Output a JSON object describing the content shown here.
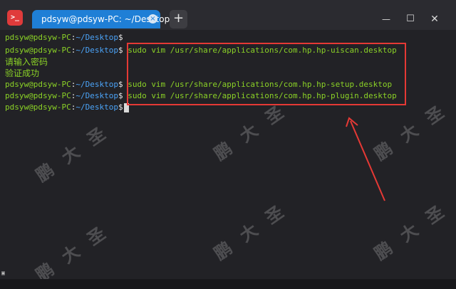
{
  "titlebar": {
    "app_icon_text": ">_",
    "tab_label": "pdsyw@pdsyw-PC: ~/Desktop",
    "tab_close": "×",
    "new_tab": "+",
    "minimize": "—",
    "maximize": "☐",
    "close": "✕"
  },
  "terminal": {
    "lines": [
      {
        "user": "pdsyw@pdsyw-PC",
        "sep": ":",
        "path": "~/Desktop",
        "sign": "$",
        "cmd": ""
      },
      {
        "user": "pdsyw@pdsyw-PC",
        "sep": ":",
        "path": "~/Desktop",
        "sign": "$",
        "cmd": " sudo vim /usr/share/applications/com.hp.hp-uiscan.desktop"
      },
      {
        "text": "请输入密码"
      },
      {
        "text": "验证成功"
      },
      {
        "user": "pdsyw@pdsyw-PC",
        "sep": ":",
        "path": "~/Desktop",
        "sign": "$",
        "cmd": " sudo vim /usr/share/applications/com.hp.hp-setup.desktop"
      },
      {
        "user": "pdsyw@pdsyw-PC",
        "sep": ":",
        "path": "~/Desktop",
        "sign": "$",
        "cmd": " sudo vim /usr/share/applications/com.hp.hp-plugin.desktop"
      },
      {
        "user": "pdsyw@pdsyw-PC",
        "sep": ":",
        "path": "~/Desktop",
        "sign": "$",
        "cmd": ""
      }
    ]
  },
  "annotation": {
    "box_color": "#e53935",
    "arrow_color": "#e53935"
  },
  "watermark": {
    "text": "鹏大圣"
  },
  "colors": {
    "prompt_user": "#8bd226",
    "prompt_path": "#4ba3f7",
    "tab_active": "#1f7fd6"
  }
}
